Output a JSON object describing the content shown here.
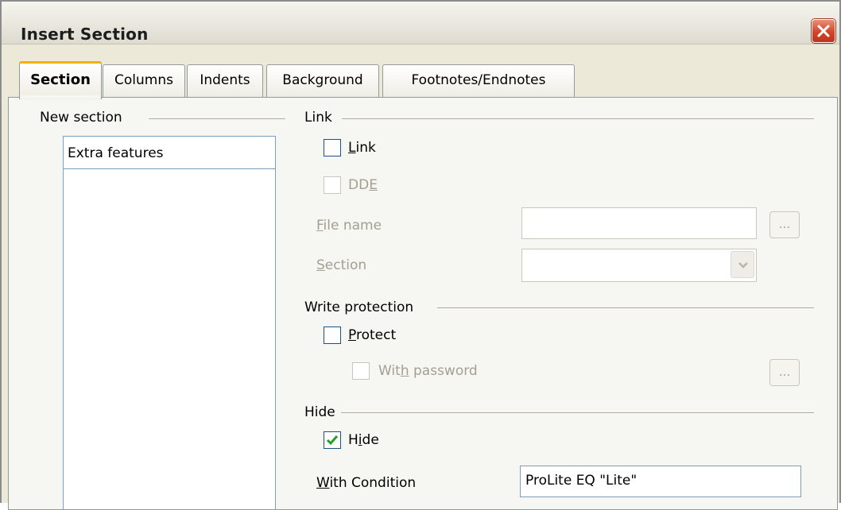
{
  "window": {
    "title": "Insert Section"
  },
  "tabs": [
    {
      "label": "Section",
      "active": true
    },
    {
      "label": "Columns",
      "active": false
    },
    {
      "label": "Indents",
      "active": false
    },
    {
      "label": "Background",
      "active": false
    },
    {
      "label": "Footnotes/Endnotes",
      "active": false
    }
  ],
  "new_section": {
    "label": "New section",
    "name_value": "Extra features"
  },
  "link": {
    "group_label": "Link",
    "link_checkbox": {
      "label_pre": "",
      "label_ul": "L",
      "label_post": "ink",
      "checked": false
    },
    "dde_checkbox": {
      "label_pre": "DD",
      "label_ul": "E",
      "label_post": "",
      "checked": false,
      "enabled": false
    },
    "file_name_label": {
      "pre": "",
      "ul": "F",
      "post": "ile name"
    },
    "file_name_value": "",
    "browse_button": "...",
    "section_label": {
      "pre": "",
      "ul": "S",
      "post": "ection"
    },
    "section_value": ""
  },
  "write_protection": {
    "group_label": "Write protection",
    "protect_checkbox": {
      "label_pre": "",
      "label_ul": "P",
      "label_post": "rotect",
      "checked": false
    },
    "with_password_checkbox": {
      "label_pre": "Wit",
      "label_ul": "h",
      "label_post": " password",
      "checked": false,
      "enabled": false
    },
    "password_button": "..."
  },
  "hide": {
    "group_label": "Hide",
    "hide_checkbox": {
      "label_pre": "H",
      "label_ul": "i",
      "label_post": "de",
      "checked": true
    },
    "condition_label": {
      "pre": "",
      "ul": "W",
      "post": "ith Condition"
    },
    "condition_value": "ProLite EQ \"Lite\""
  },
  "colors": {
    "title_bar": "#dedbd0",
    "tab_active_accent": "#f4b000",
    "close_button": "#d2452b",
    "checkmark": "#21a121",
    "disabled_text": "#a3a091"
  }
}
